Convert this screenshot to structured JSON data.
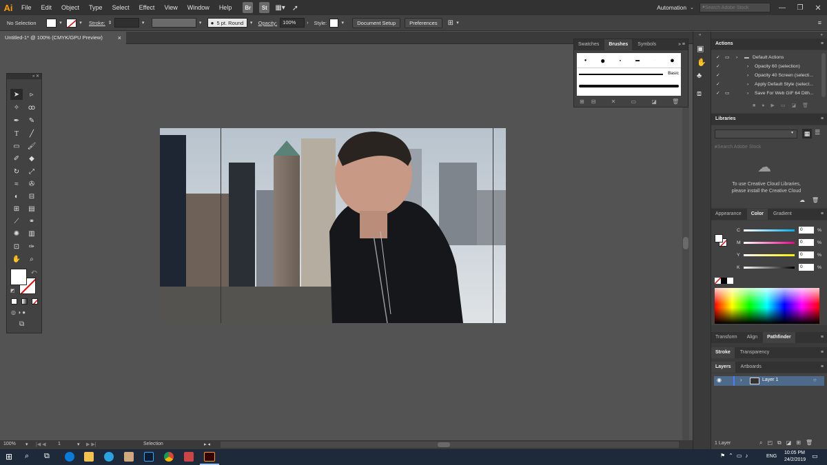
{
  "app": {
    "logo": "Ai"
  },
  "menu": [
    "File",
    "Edit",
    "Object",
    "Type",
    "Select",
    "Effect",
    "View",
    "Window",
    "Help"
  ],
  "menu_badges": [
    "Br",
    "St"
  ],
  "workspace": {
    "label": "Automation",
    "search_placeholder": "Search Adobe Stock"
  },
  "control": {
    "selection": "No Selection",
    "stroke_label": "Stroke:",
    "brush": "5 pt. Round",
    "opacity_label": "Opacity:",
    "opacity_value": "100%",
    "style_label": "Style:",
    "doc_setup": "Document Setup",
    "preferences": "Preferences"
  },
  "document": {
    "tab_title": "Untitled-1* @ 100% (CMYK/GPU Preview)",
    "close": "×"
  },
  "brushes_panel": {
    "tabs": [
      "Swatches",
      "Brushes",
      "Symbols"
    ],
    "active": "Brushes",
    "basic_label": "Basic"
  },
  "actions_panel": {
    "title": "Actions",
    "set_name": "Default Actions",
    "items": [
      "Opacity 60 (selection)",
      "Opacity 40 Screen (selecti...",
      "Apply Default Style (select...",
      "Save For Web GIF 64 Dith..."
    ]
  },
  "libraries_panel": {
    "title": "Libraries",
    "search_placeholder": "Search Adobe Stock",
    "message_line1": "To use Creative Cloud Libraries,",
    "message_line2": "please install the Creative Cloud"
  },
  "color_panel": {
    "tabs": [
      "Appearance",
      "Color",
      "Gradient"
    ],
    "active": "Color",
    "channels": [
      {
        "label": "C",
        "value": "0",
        "unit": "%"
      },
      {
        "label": "M",
        "value": "0",
        "unit": "%"
      },
      {
        "label": "Y",
        "value": "0",
        "unit": "%"
      },
      {
        "label": "K",
        "value": "0",
        "unit": "%"
      }
    ]
  },
  "transform_tabs": [
    "Transform",
    "Align",
    "Pathfinder"
  ],
  "stroke_tabs": [
    "Stroke",
    "Transparency"
  ],
  "layers_panel": {
    "tabs": [
      "Layers",
      "Artboards"
    ],
    "layer_name": "Layer 1",
    "footer": "1 Layer"
  },
  "status": {
    "zoom": "100%",
    "artboard": "1",
    "tool": "Selection"
  },
  "taskbar": {
    "language": "ENG",
    "time": "10:05 PM",
    "date": "24/2/2019"
  },
  "colors": {
    "accent": "#ff9a00",
    "panel": "#424242",
    "canvas": "#535353",
    "menubar": "#323232"
  }
}
